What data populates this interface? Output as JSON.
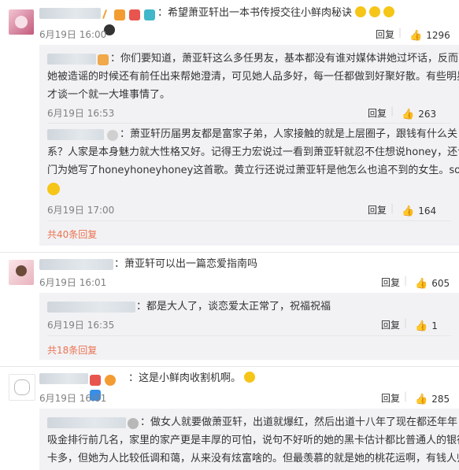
{
  "colors": {
    "accent": "#eb7350",
    "text": "#333333",
    "meta": "#808080",
    "sub_bg": "#f2f2f5"
  },
  "icons": {
    "like": "thumbs-up-icon",
    "emoji": "face-emoji-icon",
    "badge": "verified-badge-icon"
  },
  "c1": {
    "sep": "：",
    "text": "希望萧亚轩出一本书传授交往小鲜肉秘诀",
    "time": "6月19日 16:00",
    "reply": "回复",
    "likes": "1296",
    "replies": [
      {
        "sep": "：",
        "text_l1": "你们要知道，萧亚轩这么多任男友，基本都没有谁对媒体讲她过坏话，反而",
        "text_l2": "她被造谣的时候还有前任出来帮她澄清，可见她人品多好，每一任都做到好聚好散。有些明星",
        "text_l3": "才谈一个就一大堆事情了。",
        "time": "6月19日 16:53",
        "reply": "回复",
        "likes": "263"
      },
      {
        "sep": "：",
        "text_l1": "萧亚轩历届男友都是富家子弟，人家接触的就是上层圈子，跟钱有什么关",
        "text_l2": "系？人家是本身魅力就大性格又好。记得王力宏说过一看到萧亚轩就忍不住想说honey，还专",
        "text_l3": "门为她写了honeyhoneyhoney这首歌。黄立行还说过萧亚轩是他怎么也追不到的女生。so...",
        "time": "6月19日 17:00",
        "reply": "回复",
        "likes": "164"
      }
    ],
    "more": "共40条回复"
  },
  "c2": {
    "sep": "：",
    "text": "萧亚轩可以出一篇恋爱指南吗",
    "time": "6月19日 16:01",
    "reply": "回复",
    "likes": "605",
    "replies": [
      {
        "sep": "：",
        "text": "都是大人了，谈恋爱太正常了，祝福祝福",
        "time": "6月19日 16:35",
        "reply": "回复",
        "likes": "1"
      }
    ],
    "more": "共18条回复"
  },
  "c3": {
    "sep": "：",
    "text": "这是小鲜肉收割机啊。",
    "time": "6月19日 16:01",
    "reply": "回复",
    "likes": "285",
    "replies": [
      {
        "sep": "：",
        "text_l1": "做女人就要做萧亚轩，出道就爆红，然后出道十八年了现在都还年年",
        "text_l2": "吸金排行前几名，家里的家产更是丰厚的可怕，说句不好听的她的黑卡估计都比普通人的银行",
        "text_l3": "卡多，但她为人比较低调和蔼，从来没有炫富啥的。但最羡慕的就是她的桃花运啊，有钱人帅"
      }
    ]
  }
}
